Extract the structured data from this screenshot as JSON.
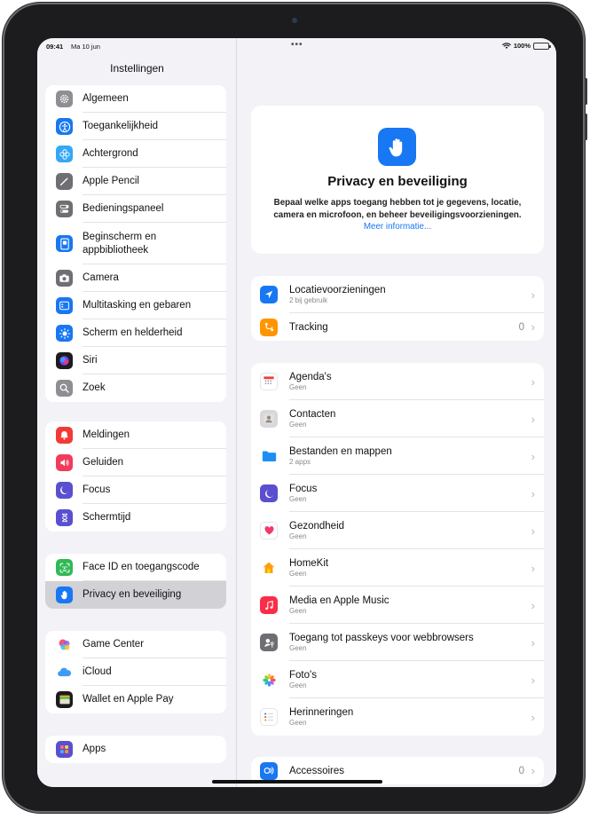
{
  "status_bar": {
    "time": "09:41",
    "date": "Ma 10 jun",
    "dots": "•••",
    "battery": "100%"
  },
  "sidebar": {
    "title": "Instellingen",
    "groups": [
      [
        {
          "label": "Algemeen",
          "icon": "gear-icon",
          "color": "#8e8e93"
        },
        {
          "label": "Toegankelijkheid",
          "icon": "accessibility-icon",
          "color": "#1877f2"
        },
        {
          "label": "Achtergrond",
          "icon": "flower-icon",
          "color": "#34a7f5"
        },
        {
          "label": "Apple Pencil",
          "icon": "pencil-icon",
          "color": "#6e6e73"
        },
        {
          "label": "Bedieningspaneel",
          "icon": "toggles-icon",
          "color": "#6e6e73"
        },
        {
          "label": "Beginscherm en appbibliotheek",
          "icon": "home-screen-icon",
          "color": "#1877f2"
        },
        {
          "label": "Camera",
          "icon": "camera-icon",
          "color": "#6e6e73"
        },
        {
          "label": "Multitasking en gebaren",
          "icon": "multitasking-icon",
          "color": "#1877f2"
        },
        {
          "label": "Scherm en helderheid",
          "icon": "sun-icon",
          "color": "#1877f2"
        },
        {
          "label": "Siri",
          "icon": "siri-icon",
          "color": "#1c1c1e"
        },
        {
          "label": "Zoek",
          "icon": "search-icon",
          "color": "#8e8e93"
        }
      ],
      [
        {
          "label": "Meldingen",
          "icon": "bell-icon",
          "color": "#f23b36"
        },
        {
          "label": "Geluiden",
          "icon": "speaker-icon",
          "color": "#f23b5b"
        },
        {
          "label": "Focus",
          "icon": "moon-icon",
          "color": "#5a4fcf"
        },
        {
          "label": "Schermtijd",
          "icon": "hourglass-icon",
          "color": "#5a4fcf"
        }
      ],
      [
        {
          "label": "Face ID en toegangscode",
          "icon": "face-id-icon",
          "color": "#30b955"
        },
        {
          "label": "Privacy en beveiliging",
          "icon": "hand-icon",
          "color": "#1877f2",
          "selected": true
        }
      ],
      [
        {
          "label": "Game Center",
          "icon": "game-center-icon",
          "color": "#ffffff"
        },
        {
          "label": "iCloud",
          "icon": "cloud-icon",
          "color": "#ffffff"
        },
        {
          "label": "Wallet en Apple Pay",
          "icon": "wallet-icon",
          "color": "#1c1c1e"
        }
      ],
      [
        {
          "label": "Apps",
          "icon": "apps-grid-icon",
          "color": "#5a4fcf"
        }
      ]
    ]
  },
  "detail": {
    "hero": {
      "title": "Privacy en beveiliging",
      "description": "Bepaal welke apps toegang hebben tot je gegevens, locatie, camera en microfoon, en beheer beveiligingsvoorzieningen.",
      "link": "Meer informatie..."
    },
    "section1": [
      {
        "label": "Locatievoorzieningen",
        "sub": "2 bij gebruik",
        "value": "",
        "icon": "location-arrow-icon",
        "color": "#1877f2"
      },
      {
        "label": "Tracking",
        "sub": "",
        "value": "0",
        "icon": "tracking-icon",
        "color": "#ff9500"
      }
    ],
    "section2": [
      {
        "label": "Agenda's",
        "sub": "Geen",
        "icon": "calendar-icon",
        "color": "#ffffff"
      },
      {
        "label": "Contacten",
        "sub": "Geen",
        "icon": "contacts-icon",
        "color": "#d8d8dc"
      },
      {
        "label": "Bestanden en mappen",
        "sub": "2 apps",
        "icon": "folder-icon",
        "color": "#ffffff"
      },
      {
        "label": "Focus",
        "sub": "Geen",
        "icon": "moon-icon",
        "color": "#5a4fcf"
      },
      {
        "label": "Gezondheid",
        "sub": "Geen",
        "icon": "heart-icon",
        "color": "#ffffff"
      },
      {
        "label": "HomeKit",
        "sub": "Geen",
        "icon": "house-icon",
        "color": "#ffffff"
      },
      {
        "label": "Media en Apple Music",
        "sub": "Geen",
        "icon": "music-note-icon",
        "color": "#fa2d48"
      },
      {
        "label": "Toegang tot passkeys voor webbrowsers",
        "sub": "Geen",
        "icon": "passkey-icon",
        "color": "#6e6e73"
      },
      {
        "label": "Foto's",
        "sub": "Geen",
        "icon": "photos-icon",
        "color": "#ffffff"
      },
      {
        "label": "Herinneringen",
        "sub": "Geen",
        "icon": "reminders-icon",
        "color": "#ffffff"
      }
    ],
    "section3": [
      {
        "label": "Accessoires",
        "sub": "",
        "value": "0",
        "icon": "accessories-icon",
        "color": "#1877f2"
      }
    ]
  }
}
